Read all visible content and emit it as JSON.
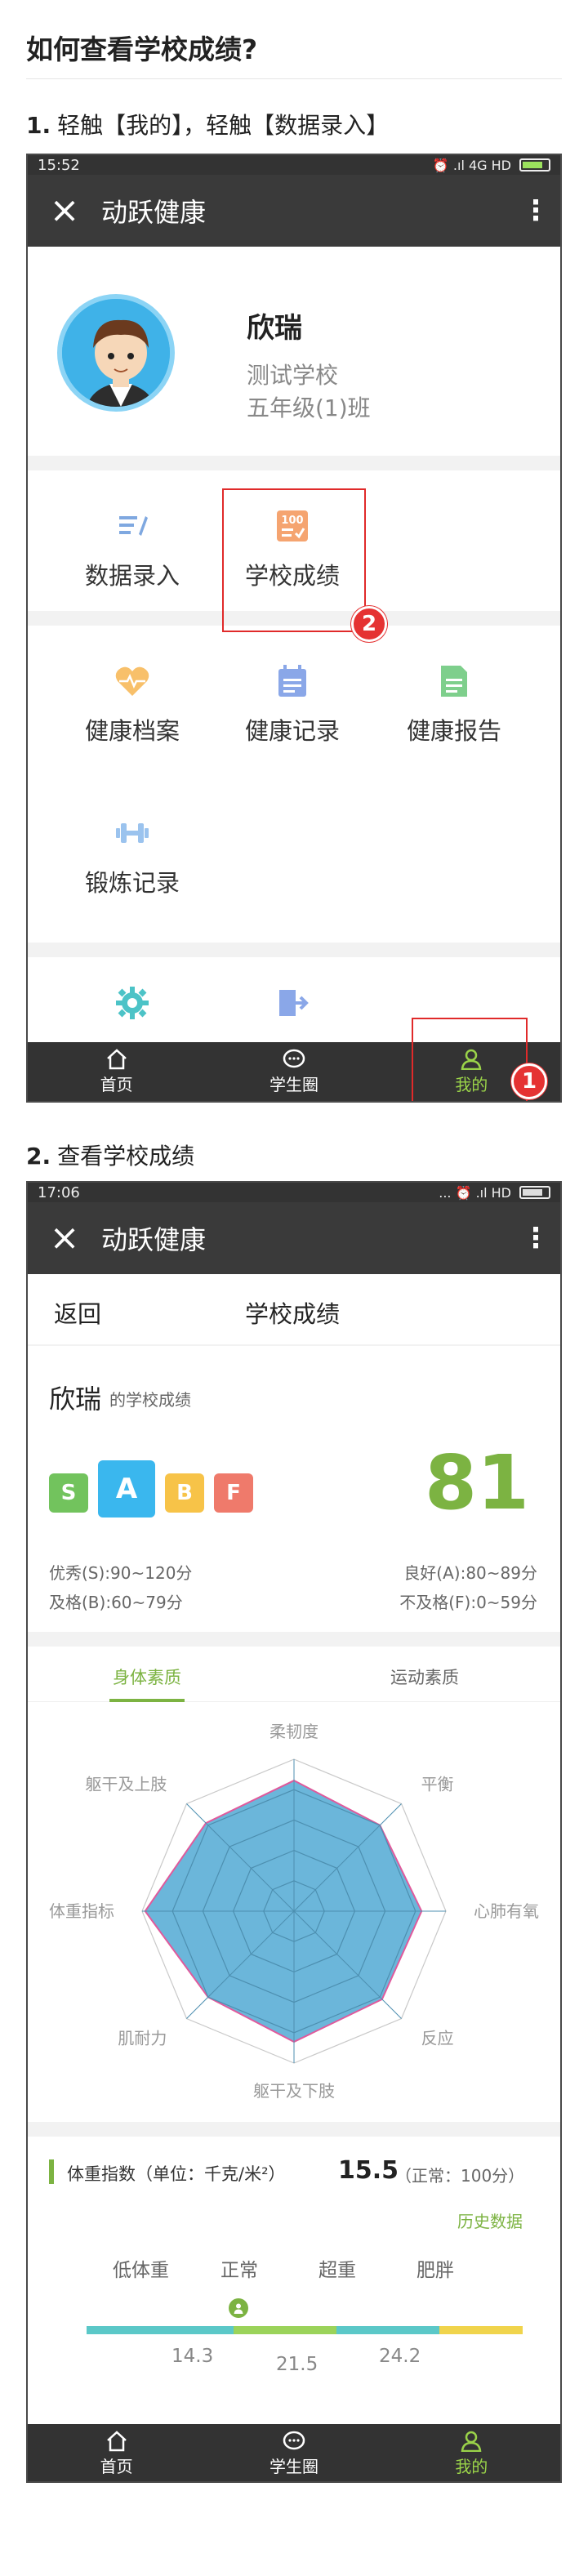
{
  "title": "如何查看学校成绩?",
  "steps": [
    {
      "num": "1.",
      "text": "轻触【我的】，轻触【数据录入】"
    },
    {
      "num": "2.",
      "text": "查看学校成绩"
    }
  ],
  "phone1": {
    "time": "15:52",
    "status_right": "⏰ .ıl 4G HD",
    "app_title": "动跃健康",
    "user": {
      "name": "欣瑞",
      "school": "测试学校",
      "class": "五年级(1)班"
    },
    "row1": [
      {
        "label": "数据录入"
      },
      {
        "label": "学校成绩"
      }
    ],
    "row2": [
      {
        "label": "健康档案"
      },
      {
        "label": "健康记录"
      },
      {
        "label": "健康报告"
      }
    ],
    "row3": [
      {
        "label": "锻炼记录"
      }
    ],
    "badge1": "1",
    "badge2": "2"
  },
  "tabs": [
    {
      "label": "首页"
    },
    {
      "label": "学生圈"
    },
    {
      "label": "我的"
    }
  ],
  "phone2": {
    "time": "17:06",
    "status_right": "... ⏰ .ıl HD",
    "app_title": "动跃健康",
    "back": "返回",
    "page_title": "学校成绩",
    "student": "欣瑞",
    "student_suffix": "的学校成绩",
    "grades": [
      "S",
      "A",
      "B",
      "F"
    ],
    "score": "81",
    "legend": {
      "s": "优秀(S):90~120分",
      "a": "良好(A):80~89分",
      "b": "及格(B):60~79分",
      "f": "不及格(F):0~59分"
    },
    "subtabs": [
      {
        "label": "身体素质"
      },
      {
        "label": "运动素质"
      }
    ],
    "radar_labels": [
      "柔韧度",
      "平衡",
      "心肺有氧",
      "反应",
      "躯干及下肢",
      "肌耐力",
      "体重指标",
      "躯干及上肢"
    ],
    "bmi": {
      "label": "体重指数（单位：千克/米²）",
      "value": "15.5",
      "normal": "（正常：100分）",
      "history": "历史数据",
      "categories": [
        "低体重",
        "正常",
        "超重",
        "肥胖"
      ],
      "thresholds": [
        "14.3",
        "21.5",
        "24.2"
      ]
    }
  },
  "colors": {
    "green": "#8bc34a",
    "score": "#7cb342",
    "teal": "#5bc8c8",
    "yellow": "#f0d44c",
    "red": "#e02a2a"
  }
}
